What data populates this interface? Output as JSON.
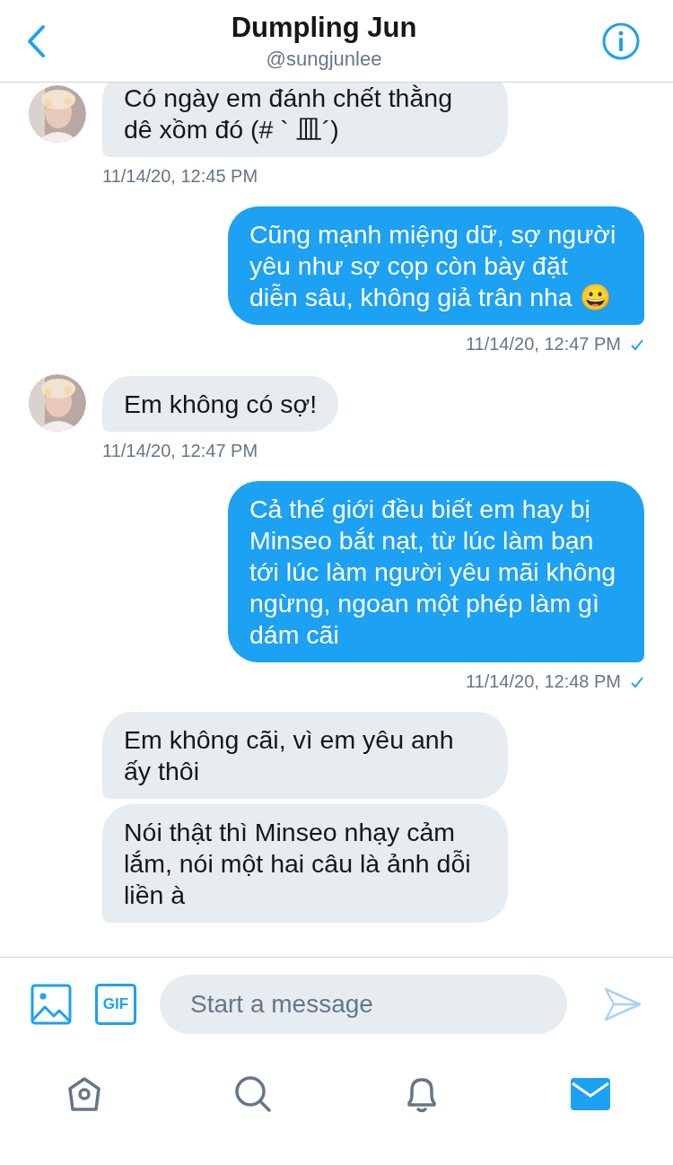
{
  "header": {
    "title": "Dumpling Jun",
    "handle": "@sungjunlee"
  },
  "messages": [
    {
      "kind": "incoming",
      "avatar": true,
      "text": "Có ngày em đánh chết thằng dê xồm đó (# ` 皿´)",
      "time": "11/14/20, 12:45 PM"
    },
    {
      "kind": "outgoing",
      "text": "Cũng mạnh miệng dữ, sợ người yêu như sợ cọp còn bày đặt diễn sâu, không giả trân nha 😀",
      "time": "11/14/20, 12:47 PM",
      "read": true
    },
    {
      "kind": "incoming",
      "avatar": true,
      "text": "Em không có sợ!",
      "time": "11/14/20, 12:47 PM"
    },
    {
      "kind": "outgoing",
      "text": "Cả thế giới đều biết em hay bị Minseo bắt nạt, từ lúc làm bạn tới lúc làm người yêu mãi không ngừng, ngoan một phép làm gì dám cãi",
      "time": "11/14/20, 12:48 PM",
      "read": true
    },
    {
      "kind": "incoming",
      "avatar": false,
      "text": "Em không cãi, vì em yêu anh ấy thôi"
    },
    {
      "kind": "incoming",
      "avatar": false,
      "text": "Nói thật thì Minseo nhạy cảm lắm, nói một hai câu là ảnh dỗi liền à"
    }
  ],
  "composer": {
    "placeholder": "Start a message",
    "gif_label": "GIF"
  },
  "tabs": [
    {
      "kind": "home",
      "selected": false
    },
    {
      "kind": "search",
      "selected": false
    },
    {
      "kind": "notifications",
      "selected": false
    },
    {
      "kind": "messages",
      "selected": true
    }
  ]
}
